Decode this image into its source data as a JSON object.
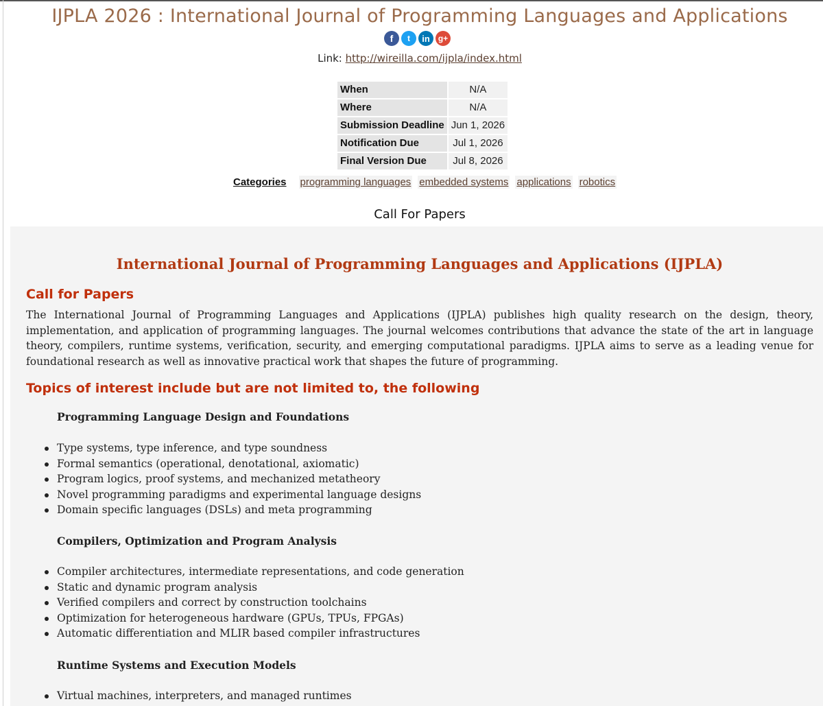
{
  "page": {
    "title": "IJPLA 2026 : International Journal of Programming Languages and Applications",
    "share_icons": [
      {
        "name": "facebook-icon",
        "glyph": "f"
      },
      {
        "name": "twitter-icon",
        "glyph": "t"
      },
      {
        "name": "linkedin-icon",
        "glyph": "in"
      },
      {
        "name": "googleplus-icon",
        "glyph": "g+"
      }
    ],
    "link_label": "Link:",
    "link_url": "http://wireilla.com/ijpla/index.html"
  },
  "info_table": [
    {
      "key": "When",
      "value": "N/A"
    },
    {
      "key": "Where",
      "value": "N/A"
    },
    {
      "key": "Submission Deadline",
      "value": "Jun 1, 2026"
    },
    {
      "key": "Notification Due",
      "value": "Jul 1, 2026"
    },
    {
      "key": "Final Version Due",
      "value": "Jul 8, 2026"
    }
  ],
  "categories": {
    "label": "Categories",
    "items": [
      "programming languages",
      "embedded systems",
      "applications",
      "robotics"
    ]
  },
  "cfp_heading": "Call For Papers",
  "content": {
    "journal_title": "International Journal of Programming Languages and Applications (IJPLA)",
    "call_heading": "Call for Papers",
    "intro": "The International Journal of Programming Languages and Applications (IJPLA) publishes high quality research on the design, theory, implementation, and application of programming languages. The journal welcomes contributions that advance the state of the art in language theory, compilers, runtime systems, verification, security, and emerging computational paradigms. IJPLA aims to serve as a leading venue for foundational research as well as innovative practical work that shapes the future of programming.",
    "topics_heading": "Topics of interest include but are not limited to, the following",
    "groups": [
      {
        "heading": "Programming Language Design and Foundations",
        "items": [
          "Type systems, type inference, and type soundness",
          "Formal semantics (operational, denotational, axiomatic)",
          "Program logics, proof systems, and mechanized metatheory",
          "Novel programming paradigms and experimental language designs",
          "Domain specific languages (DSLs) and meta programming"
        ]
      },
      {
        "heading": "Compilers, Optimization and Program Analysis",
        "items": [
          "Compiler architectures, intermediate representations, and code generation",
          "Static and dynamic program analysis",
          "Verified compilers and correct by construction toolchains",
          "Optimization for heterogeneous hardware (GPUs, TPUs, FPGAs)",
          "Automatic differentiation and MLIR based compiler infrastructures"
        ]
      },
      {
        "heading": "Runtime Systems and Execution Models",
        "items": [
          "Virtual machines, interpreters, and managed runtimes"
        ]
      }
    ]
  }
}
